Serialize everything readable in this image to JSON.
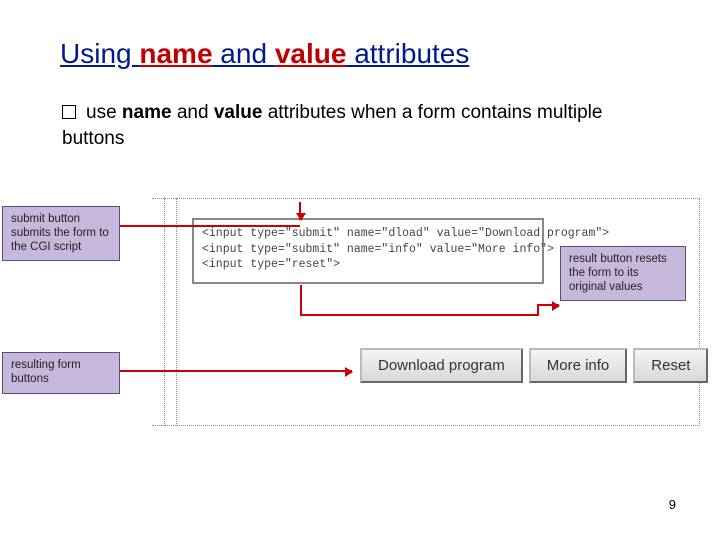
{
  "title": {
    "t1": "Using ",
    "name_word": "name",
    "t2": " and ",
    "value_word": "value",
    "t3": " attributes"
  },
  "bullet": {
    "pre": "use ",
    "name_word": "name",
    "mid": " and ",
    "value_word": "value",
    "post": " attributes when a form contains multiple buttons"
  },
  "callouts": {
    "a": "submit button submits the form to the CGI script",
    "b": "result button resets the form to its original values",
    "c": "resulting form buttons"
  },
  "code": {
    "l1": "<input type=\"submit\" name=\"dload\" value=\"Download program\">",
    "l2": "<input type=\"submit\" name=\"info\" value=\"More info\">",
    "l3": "<input type=\"reset\">"
  },
  "buttons": {
    "download": "Download program",
    "more": "More info",
    "reset": "Reset"
  },
  "page_number": "9"
}
